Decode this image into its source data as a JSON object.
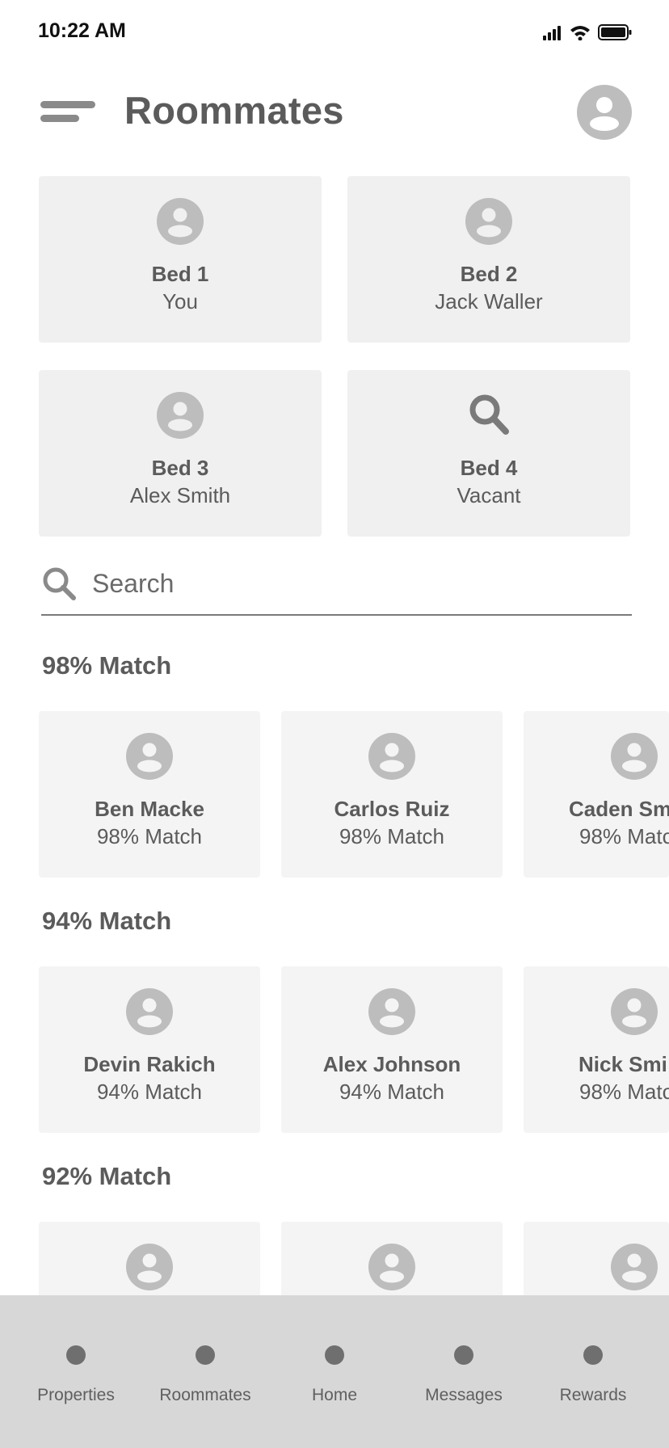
{
  "status_bar": {
    "time": "10:22 AM",
    "icons": [
      "signal-icon",
      "wifi-icon",
      "battery-icon"
    ]
  },
  "header": {
    "title": "Roommates",
    "menu_icon": "menu-icon",
    "avatar_icon": "user-avatar-icon"
  },
  "beds": [
    {
      "label": "Bed 1",
      "occupant": "You",
      "icon": "user-avatar-icon"
    },
    {
      "label": "Bed 2",
      "occupant": "Jack Waller",
      "icon": "user-avatar-icon"
    },
    {
      "label": "Bed 3",
      "occupant": "Alex Smith",
      "icon": "user-avatar-icon"
    },
    {
      "label": "Bed 4",
      "occupant": "Vacant",
      "icon": "search-icon"
    }
  ],
  "search": {
    "placeholder": "Search"
  },
  "sections": [
    {
      "title": "98% Match",
      "cards": [
        {
          "name": "Ben Macke",
          "match": "98% Match"
        },
        {
          "name": "Carlos Ruiz",
          "match": "98% Match"
        },
        {
          "name": "Caden Sm",
          "match": "98% Matc"
        }
      ]
    },
    {
      "title": "94% Match",
      "cards": [
        {
          "name": "Devin Rakich",
          "match": "94% Match"
        },
        {
          "name": "Alex Johnson",
          "match": "94% Match"
        },
        {
          "name": "Nick Smi",
          "match": "98% Matc"
        }
      ]
    },
    {
      "title": "92% Match",
      "cards": [
        {
          "name": "",
          "match": ""
        },
        {
          "name": "",
          "match": ""
        },
        {
          "name": "",
          "match": ""
        }
      ]
    }
  ],
  "bottom_nav": [
    {
      "label": "Properties"
    },
    {
      "label": "Roommates"
    },
    {
      "label": "Home"
    },
    {
      "label": "Messages"
    },
    {
      "label": "Rewards"
    }
  ],
  "colors": {
    "text": "#5b5b5b",
    "card_bg": "#f0f0f0",
    "icon_gray": "#bdbdbd",
    "nav_bg": "#d7d7d7"
  }
}
